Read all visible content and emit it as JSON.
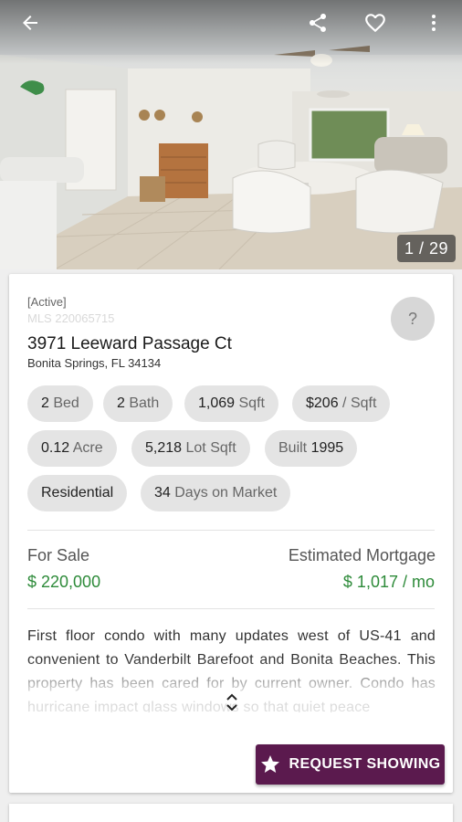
{
  "photo": {
    "counter": "1 / 29"
  },
  "icons": {
    "back": "arrow-back-icon",
    "share": "share-icon",
    "favorite": "heart-outline-icon",
    "more": "more-vert-icon",
    "help": "help-icon",
    "expand": "unfold-more-icon",
    "request": "star-icon"
  },
  "listing": {
    "status": "[Active]",
    "mls": "MLS 220065715",
    "help_label": "?",
    "address": "3971 Leeward Passage Ct",
    "city_line": "Bonita Springs, FL 34134",
    "chips": [
      {
        "value": "2",
        "unit": "Bed"
      },
      {
        "value": "2",
        "unit": "Bath"
      },
      {
        "value": "1,069",
        "unit": "Sqft"
      },
      {
        "value": "$206",
        "unit": "/ Sqft"
      },
      {
        "value": "0.12",
        "unit": "Acre"
      },
      {
        "value": "5,218",
        "unit": "Lot Sqft"
      },
      {
        "unit": "Built",
        "value": "1995"
      },
      {
        "value": "Residential",
        "unit": ""
      },
      {
        "value": "34",
        "unit": "Days on Market"
      }
    ],
    "for_sale_label": "For Sale",
    "price": "$ 220,000",
    "mortgage_label": "Estimated Mortgage",
    "mortgage_value": "$ 1,017 / mo",
    "description": "First floor condo with many updates west of US-41 and convenient to Vanderbilt Barefoot and Bonita Beaches. This property has been cared for by current owner. Condo has hurricane impact glass windows so that quiet peace",
    "request_label": "REQUEST SHOWING"
  },
  "colors": {
    "price_green": "#2e8b3a",
    "request_button": "#5b1a4e",
    "chip_bg": "#e4e4e4"
  }
}
